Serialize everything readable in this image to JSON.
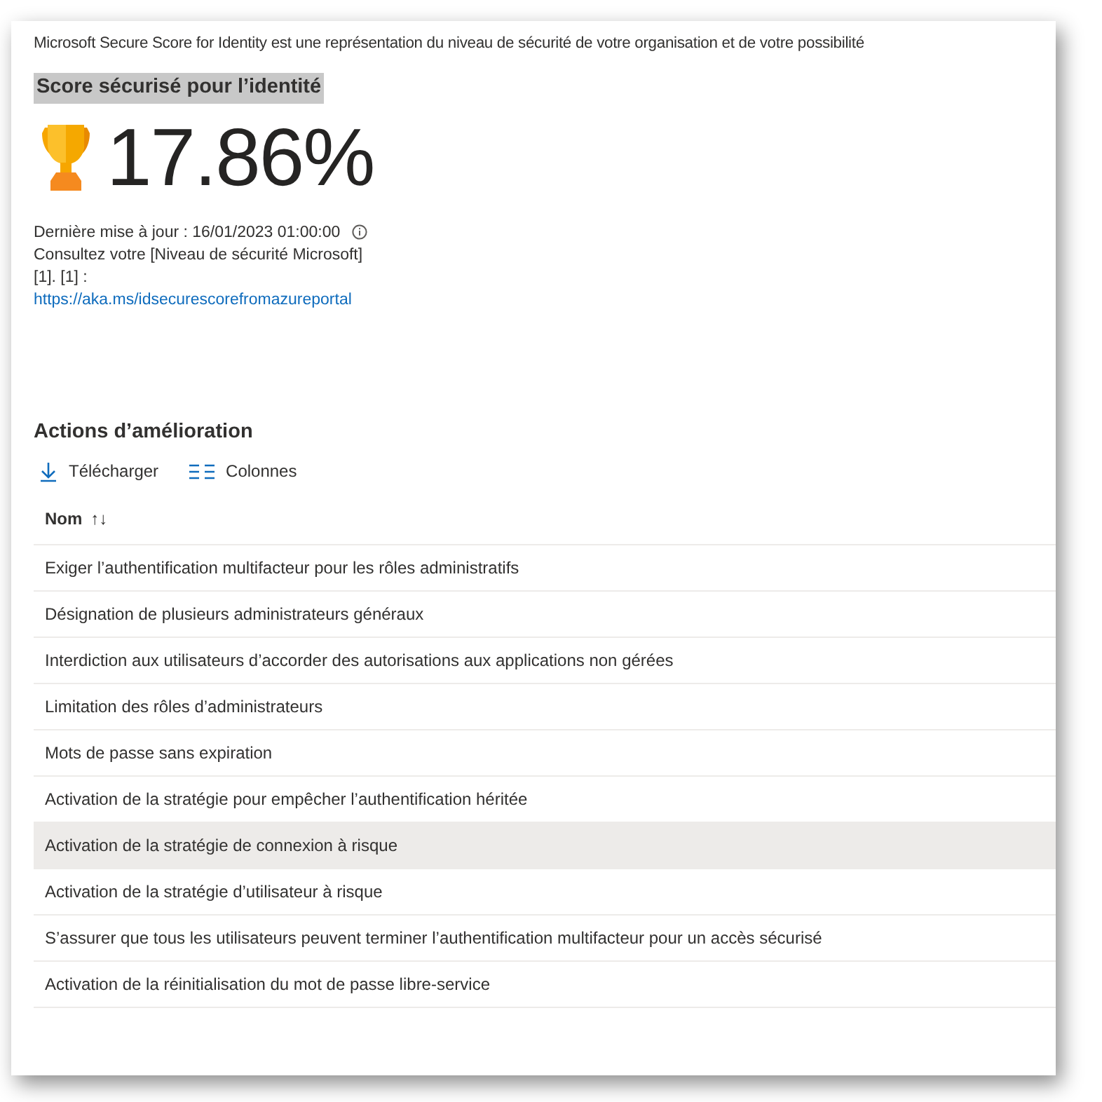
{
  "intro": "Microsoft Secure Score for Identity est une représentation du niveau de sécurité de votre organisation et de votre possibilité",
  "score_title": "Score sécurisé pour l’identité",
  "score_title_highlighted": true,
  "score": "17.86%",
  "last_update": "Dernière mise à jour : 16/01/2023 01:00:00",
  "consult_lines": [
    "Consultez votre [Niveau de sécurité Microsoft]",
    "[1]. [1] :"
  ],
  "link": "https://aka.ms/idsecurescorefromazureportal",
  "actions_title": "Actions d’amélioration",
  "toolbar": [
    {
      "kind": "download",
      "label": "Télécharger"
    },
    {
      "kind": "columns",
      "label": "Colonnes"
    }
  ],
  "table": {
    "columns": [
      {
        "label": "Nom",
        "sort": "↑↓"
      }
    ],
    "rows": [
      {
        "name": "Exiger l’authentification multifacteur pour les rôles administratifs",
        "selected": false
      },
      {
        "name": "Désignation de plusieurs administrateurs généraux",
        "selected": false
      },
      {
        "name": "Interdiction aux utilisateurs d’accorder des autorisations aux applications non gérées",
        "selected": false
      },
      {
        "name": "Limitation des rôles d’administrateurs",
        "selected": false
      },
      {
        "name": "Mots de passe sans expiration",
        "selected": false
      },
      {
        "name": "Activation de la stratégie pour empêcher l’authentification héritée",
        "selected": false
      },
      {
        "name": "Activation de la stratégie de connexion à risque",
        "selected": true
      },
      {
        "name": "Activation de la stratégie d’utilisateur à risque",
        "selected": false
      },
      {
        "name": "S’assurer que tous les utilisateurs peuvent terminer l’authentification multifacteur pour un accès sécurisé",
        "selected": false
      },
      {
        "name": "Activation de la réinitialisation du mot de passe libre-service",
        "selected": false
      }
    ]
  }
}
